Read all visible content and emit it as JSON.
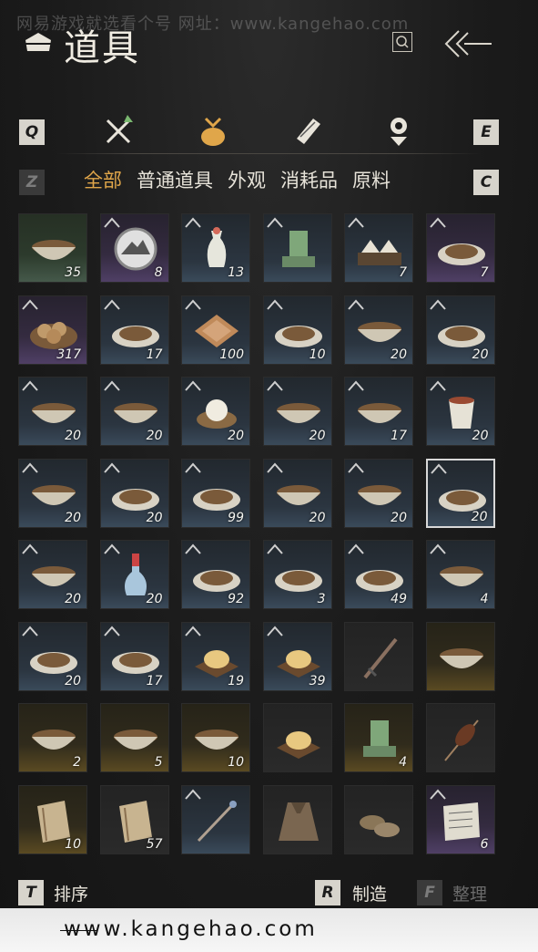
{
  "watermark_top": "网易游戏就选看个号 网址：www.kangehao.com",
  "header": {
    "title": "道具"
  },
  "keys": {
    "prev_category": "Q",
    "next_category": "E",
    "prev_subtab": "Z",
    "next_subtab": "C"
  },
  "categories": [
    {
      "name": "weapons",
      "icon": "crossed-swords-icon"
    },
    {
      "name": "items",
      "icon": "pouch-icon"
    },
    {
      "name": "scrolls",
      "icon": "scroll-icon"
    },
    {
      "name": "accessories",
      "icon": "medal-icon"
    }
  ],
  "subtabs": [
    "全部",
    "普通道具",
    "外观",
    "消耗品",
    "原料"
  ],
  "active_subtab": 0,
  "items": [
    {
      "name": "braised-dish",
      "qty": "35",
      "rarity": "green",
      "icon": "bowl"
    },
    {
      "name": "mountain-token",
      "qty": "8",
      "rarity": "purple",
      "icon": "token"
    },
    {
      "name": "porcelain-vase",
      "qty": "13",
      "rarity": "blue",
      "icon": "vase"
    },
    {
      "name": "jade-seal",
      "qty": "",
      "rarity": "blue",
      "icon": "seal"
    },
    {
      "name": "rice-cakes",
      "qty": "7",
      "rarity": "blue",
      "icon": "cakes"
    },
    {
      "name": "fried-pastry",
      "qty": "7",
      "rarity": "purple",
      "icon": "plate"
    },
    {
      "name": "baked-buns",
      "qty": "317",
      "rarity": "purple",
      "icon": "basket"
    },
    {
      "name": "sliced-meat",
      "qty": "17",
      "rarity": "blue",
      "icon": "plate"
    },
    {
      "name": "layered-cake",
      "qty": "100",
      "rarity": "blue",
      "icon": "square"
    },
    {
      "name": "flatbread",
      "qty": "10",
      "rarity": "blue",
      "icon": "plate"
    },
    {
      "name": "stew-bowl",
      "qty": "20",
      "rarity": "blue",
      "icon": "bowl"
    },
    {
      "name": "fish-plate",
      "qty": "20",
      "rarity": "blue",
      "icon": "plate"
    },
    {
      "name": "greens-soup",
      "qty": "20",
      "rarity": "blue",
      "icon": "bowl"
    },
    {
      "name": "dumpling-soup",
      "qty": "20",
      "rarity": "blue",
      "icon": "bowl"
    },
    {
      "name": "steamed-bun",
      "qty": "20",
      "rarity": "blue",
      "icon": "steamer"
    },
    {
      "name": "noodle-bowl",
      "qty": "20",
      "rarity": "blue",
      "icon": "bowl"
    },
    {
      "name": "red-soup",
      "qty": "17",
      "rarity": "blue",
      "icon": "bowl"
    },
    {
      "name": "wine-cup",
      "qty": "20",
      "rarity": "blue",
      "icon": "cup"
    },
    {
      "name": "rice-bowl",
      "qty": "20",
      "rarity": "blue",
      "icon": "bowl"
    },
    {
      "name": "stir-fried-greens",
      "qty": "20",
      "rarity": "blue",
      "icon": "plate"
    },
    {
      "name": "dumplings",
      "qty": "99",
      "rarity": "blue",
      "icon": "plate"
    },
    {
      "name": "shrimp-soup",
      "qty": "20",
      "rarity": "blue",
      "icon": "bowl"
    },
    {
      "name": "broth",
      "qty": "20",
      "rarity": "blue",
      "icon": "bowl"
    },
    {
      "name": "meat-platter",
      "qty": "20",
      "rarity": "blue",
      "icon": "plate"
    },
    {
      "name": "porridge",
      "qty": "20",
      "rarity": "blue",
      "icon": "bowl"
    },
    {
      "name": "wine-bottle",
      "qty": "20",
      "rarity": "blue",
      "icon": "bottle"
    },
    {
      "name": "vegetable-dish",
      "qty": "92",
      "rarity": "blue",
      "icon": "plate"
    },
    {
      "name": "herb-dish",
      "qty": "3",
      "rarity": "blue",
      "icon": "plate"
    },
    {
      "name": "mushroom-dish",
      "qty": "49",
      "rarity": "blue",
      "icon": "plate"
    },
    {
      "name": "spicy-dish",
      "qty": "4",
      "rarity": "blue",
      "icon": "bowl"
    },
    {
      "name": "pork-slices",
      "qty": "20",
      "rarity": "blue",
      "icon": "plate"
    },
    {
      "name": "fried-balls",
      "qty": "17",
      "rarity": "blue",
      "icon": "plate"
    },
    {
      "name": "cheese-tray",
      "qty": "19",
      "rarity": "blue",
      "icon": "tray"
    },
    {
      "name": "peach-buns",
      "qty": "39",
      "rarity": "blue",
      "icon": "tray"
    },
    {
      "name": "dagger",
      "qty": "",
      "rarity": "grey",
      "icon": "dagger"
    },
    {
      "name": "white-bowl",
      "qty": "",
      "rarity": "gold",
      "icon": "bowl"
    },
    {
      "name": "floral-bowl",
      "qty": "2",
      "rarity": "gold",
      "icon": "bowl"
    },
    {
      "name": "painted-bowl",
      "qty": "5",
      "rarity": "gold",
      "icon": "bowl"
    },
    {
      "name": "blue-rim-bowl",
      "qty": "10",
      "rarity": "gold",
      "icon": "bowl"
    },
    {
      "name": "wooden-tray",
      "qty": "",
      "rarity": "grey",
      "icon": "tray"
    },
    {
      "name": "bronze-seal",
      "qty": "4",
      "rarity": "gold",
      "icon": "seal"
    },
    {
      "name": "skewer",
      "qty": "",
      "rarity": "grey",
      "icon": "skewer"
    },
    {
      "name": "wooden-slips",
      "qty": "10",
      "rarity": "gold",
      "icon": "book"
    },
    {
      "name": "paper-scroll",
      "qty": "57",
      "rarity": "grey",
      "icon": "book"
    },
    {
      "name": "hairpin",
      "qty": "",
      "rarity": "blue",
      "icon": "pin"
    },
    {
      "name": "straw-cape",
      "qty": "",
      "rarity": "grey",
      "icon": "cape"
    },
    {
      "name": "straw-shoes",
      "qty": "",
      "rarity": "grey",
      "icon": "shoes"
    },
    {
      "name": "letter",
      "qty": "6",
      "rarity": "purple",
      "icon": "paper"
    }
  ],
  "selected_index": 23,
  "bottom": {
    "sort_key": "T",
    "sort_label": "排序",
    "craft_key": "R",
    "craft_label": "制造",
    "arrange_key": "F",
    "arrange_label": "整理"
  },
  "footer": {
    "text": "www.kangehao.com"
  },
  "colors": {
    "accent": "#e0a64a"
  }
}
